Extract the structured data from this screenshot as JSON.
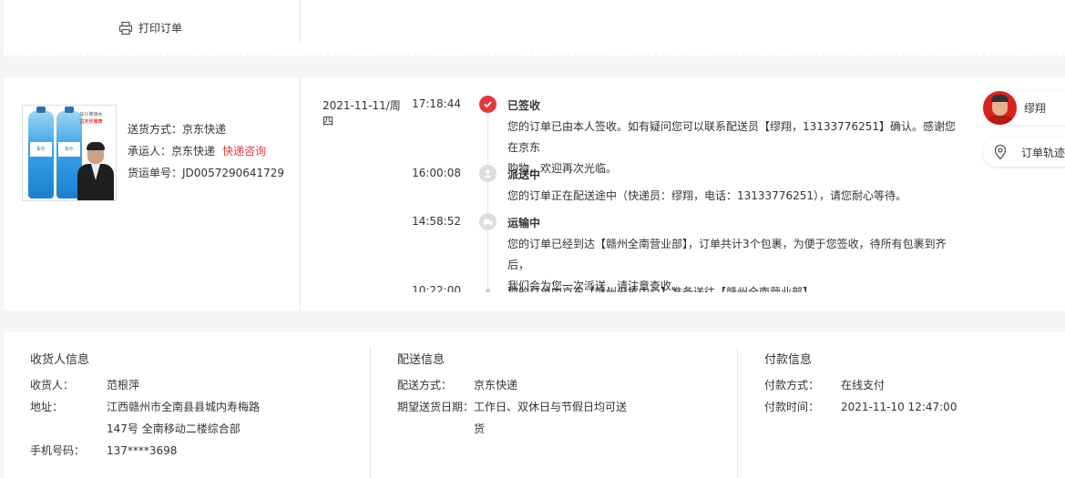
{
  "top": {
    "print_label": "打印订单"
  },
  "product": {
    "promo_line1": "车仆玻璃水",
    "promo_line2": "古天乐推荐",
    "bottle_label": "车仆"
  },
  "shipping": {
    "method_label": "送货方式：",
    "method_value": "京东快递",
    "carrier_label": "承运人：",
    "carrier_value": "京东快递",
    "consult_link": "快递咨询",
    "tracking_label": "货运单号：",
    "tracking_value": "JD0057290641729"
  },
  "timeline": [
    {
      "date": "2021-11-11/周四",
      "time": "17:18:44",
      "status": "已签收",
      "lines": [
        "您的订单已由本人签收。如有疑问您可以联系配送员【缪翔，13133776251】确认。感谢您在京东",
        "购物，欢迎再次光临。"
      ]
    },
    {
      "date": "",
      "time": "16:00:08",
      "status": "派送中",
      "lines": [
        "您的订单正在配送途中（快递员：缪翔，电话：13133776251），请您耐心等待。"
      ]
    },
    {
      "date": "",
      "time": "14:58:52",
      "status": "运输中",
      "lines": [
        "您的订单已经到达【赣州全南营业部】，订单共计3个包裹，为便于您签收，待所有包裹到齐后，",
        "我们会为您一次派送，请注意查收。"
      ]
    },
    {
      "date": "",
      "time": "10:22:00",
      "status": "",
      "lines": [
        "您的订单由京东【赣州分拣中心】准备送往【赣州全南营业部】"
      ]
    }
  ],
  "courier": {
    "name": "缪翔",
    "track_label": "订单轨迹"
  },
  "receiver": {
    "title": "收货人信息",
    "name_label": "收货人：",
    "name_value": "范根萍",
    "addr_label": "地址：",
    "addr_line1": "江西赣州市全南县县城内寿梅路",
    "addr_line2": "147号 全南移动二楼综合部",
    "phone_label": "手机号码：",
    "phone_value": "137****3698"
  },
  "delivery": {
    "title": "配送信息",
    "method_label": "配送方式：",
    "method_value": "京东快递",
    "expect_label": "期望送货日期：",
    "expect_line1": "工作日、双休日与节假日均可送",
    "expect_line2": "货"
  },
  "payment": {
    "title": "付款信息",
    "method_label": "付款方式：",
    "method_value": "在线支付",
    "time_label": "付款时间：",
    "time_value": "2021-11-10 12:47:00"
  },
  "colors": {
    "accent": "#e4393c",
    "muted_dot": "#dddddd",
    "divider": "#e8e8e8"
  }
}
